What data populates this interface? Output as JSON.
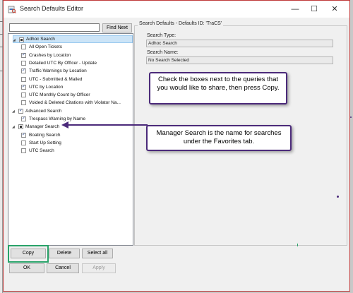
{
  "window": {
    "title": "Search Defaults Editor",
    "min_symbol": "—",
    "max_symbol": "☐",
    "close_symbol": "✕"
  },
  "search": {
    "value": "",
    "find_next_label": "Find Next"
  },
  "tree": [
    {
      "label": "Adhoc Search",
      "type": "group",
      "state": "partial",
      "selected": true
    },
    {
      "label": "All Open Tickets",
      "type": "item",
      "checked": false
    },
    {
      "label": "Crashes by Location",
      "type": "item",
      "checked": true
    },
    {
      "label": "Detailed UTC By Officer - Update",
      "type": "item",
      "checked": false
    },
    {
      "label": "Traffic Warnings by Location",
      "type": "item",
      "checked": true
    },
    {
      "label": "UTC - Submitted & Mailed",
      "type": "item",
      "checked": false
    },
    {
      "label": "UTC by Location",
      "type": "item",
      "checked": true
    },
    {
      "label": "UTC Monthly Count by Officer",
      "type": "item",
      "checked": false
    },
    {
      "label": "Voided & Deleted Citations with Violator Na...",
      "type": "item",
      "checked": false
    },
    {
      "label": "Advanced Search",
      "type": "group",
      "state": "checked"
    },
    {
      "label": "Trespass Warning by Name",
      "type": "item",
      "checked": true
    },
    {
      "label": "Manager Search",
      "type": "group",
      "state": "partial"
    },
    {
      "label": "Boating Search",
      "type": "item",
      "checked": true
    },
    {
      "label": "Start Up Setting",
      "type": "item",
      "checked": false
    },
    {
      "label": "UTC Search",
      "type": "item",
      "checked": false
    }
  ],
  "details": {
    "group_title": "Search Defaults - Defaults ID: 'TraCS'",
    "search_type_label": "Search Type:",
    "search_type_value": "Adhoc Search",
    "search_name_label": "Search Name:",
    "search_name_value": "No Search Selected"
  },
  "callouts": {
    "share": "Check the boxes next to the queries that you would like to share, then press Copy.",
    "manager": "Manager Search is the name for searches under the Favorites tab."
  },
  "buttons": {
    "copy": "Copy",
    "delete": "Delete",
    "select_all": "Select all",
    "ok": "OK",
    "cancel": "Cancel",
    "apply": "Apply"
  },
  "colors": {
    "callout_border": "#4b2a7a",
    "highlight": "#2aa36a",
    "window_border": "#c03a3a",
    "selection": "#cce4f7"
  }
}
